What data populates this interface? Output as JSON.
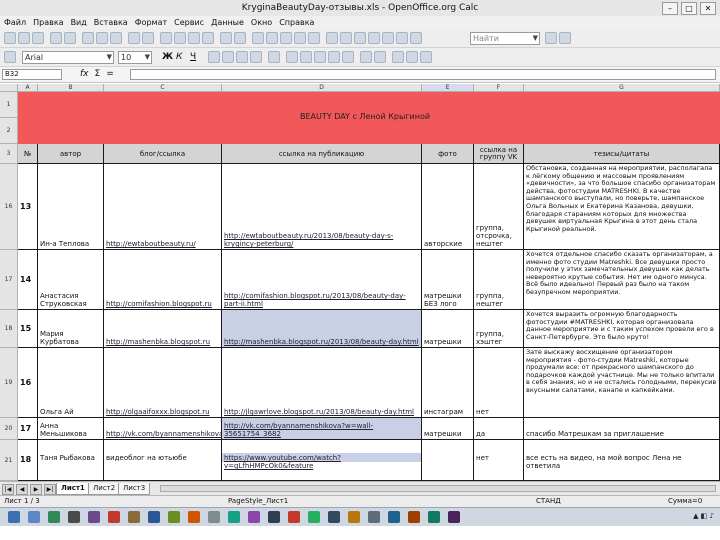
{
  "window": {
    "title": "KryginaBeautyDay-отзывы.xls - OpenOffice.org Calc"
  },
  "menu": [
    "Файл",
    "Правка",
    "Вид",
    "Вставка",
    "Формат",
    "Сервис",
    "Данные",
    "Окно",
    "Справка"
  ],
  "toolbar": {
    "font_name": "Arial",
    "font_size": "10",
    "bold": "Ж",
    "italic": "К",
    "underline": "Ч",
    "search_placeholder": "Найти"
  },
  "formula_bar": {
    "cell_ref": "B32",
    "fx": "fx",
    "sum": "Σ",
    "equals": "="
  },
  "columns": [
    "A",
    "B",
    "C",
    "D",
    "E",
    "F",
    "G"
  ],
  "banner": {
    "title": "BEAUTY DAY с Леной Крыгиной",
    "row1": "1",
    "row2": "2"
  },
  "header_row": {
    "row": "3",
    "num": "№",
    "author": "автор",
    "blog": "блог/ссылка",
    "link": "ссылка на публикацию",
    "photo": "фото",
    "vk": "ссылка на группу VK",
    "thesis": "тезисы/цитаты"
  },
  "rows": [
    {
      "row": "16",
      "num": "13",
      "author": "Ин-а Теплова",
      "blog": "http://ewtaboutbeauty.ru/",
      "link": "http://ewtaboutbeauty.ru/2013/08/beauty-day-s-krygincy-peterburg/",
      "photo": "авторские",
      "vk": "группа, отсрочка, нештег",
      "thesis": "Обстановка, созданная на мероприятии, располагала к лёгкому общению и массовым проявлениям «девичности», за что большое спасибо организаторам действа, фотостудии MATRESHKI. В качестве шампанского выступали, но поверьте, шампанское Ольга Вольных и Екатерина Казанова, девушки, благодаря стараниям которых для множества девушек виртуальная Крыгина в этот день стала Крыгиной реальной."
    },
    {
      "row": "17",
      "num": "14",
      "author": "Анастасия Струковская",
      "blog": "http://comifashion.blogspot.ru",
      "link": "http://comifashion.blogspot.ru/2013/08/beauty-day-part-ii.html",
      "photo": "матрешки БЕЗ лого",
      "vk": "группа, нештег",
      "thesis": "Хочется отдельное спасибо сказать организаторам, а именно фото студии Matreshki. Все девушки просто получили у этих замечательных девушек как делать невероятно крутые события. Нет им одного минуса. Всё было идеально! Первый раз было на таком безупречном мероприятии."
    },
    {
      "row": "18",
      "num": "15",
      "author": "Мария Курбатова",
      "blog": "http://mashenbka.blogspot.ru",
      "link": "http://mashenbka.blogspot.ru/2013/08/beauty-day.html",
      "photo": "матрешки",
      "vk": "группа, хэштег",
      "thesis": "Хочется выразить огромную благодарность фотостудии #MATRESHKI, которая организовала данное мероприятие и с таким успехом провели его в Санкт-Петербурге. Это было круто!"
    },
    {
      "row": "19",
      "num": "16",
      "author": "Ольга Ай",
      "blog": "http://olgaaifoxxx.blogspot.ru",
      "link": "http://jlgawrlove.blogspot.ru/2013/08/beauty-day.html",
      "photo": "инстаграм",
      "vk": "нет",
      "thesis": "Зате выскажу восхищение организатором мероприятия - фото-студии Matreshki, которые продумали все: от прекрасного шампанского до подарочков каждой участнице. Мы не только впитали в себя знания, но и не остались голодными, перекусив вкусными салатами, канапе и капкейками."
    },
    {
      "row": "20",
      "num": "17",
      "author": "Анна Меньшикова",
      "blog": "http://vk.com/byannamenshikova",
      "link": "http://vk.com/byannamenshikova?w=wall-35651754_3682",
      "photo": "матрешки",
      "vk": "да",
      "thesis": "спасибо Матрешкам за приглашение"
    },
    {
      "row": "21",
      "num": "18",
      "author": "Таня Рыбакова",
      "blog": "видеоблог на ютьюбе",
      "link": "https://www.youtube.com/watch?v=gLfhHMPcOk0&feature",
      "photo": "",
      "vk": "нет",
      "thesis": "все есть на видео, на мой вопрос Лена не ответила"
    }
  ],
  "sheet_tabs": {
    "nav": [
      "|◀",
      "◀",
      "▶",
      "▶|"
    ],
    "tabs": [
      "Лист1",
      "Лист2",
      "Лист3"
    ],
    "active": "Лист1"
  },
  "status": {
    "sheet": "Лист 1 / 3",
    "page_style": "PageStyle_Лист1",
    "mode": "СТАНД",
    "sum": "Сумма=0"
  },
  "colors": {
    "banner": "#f2585a",
    "header_fill": "#d4d4d4",
    "highlight": "#c9d0e6",
    "taskbar": "#cfd7e3"
  }
}
